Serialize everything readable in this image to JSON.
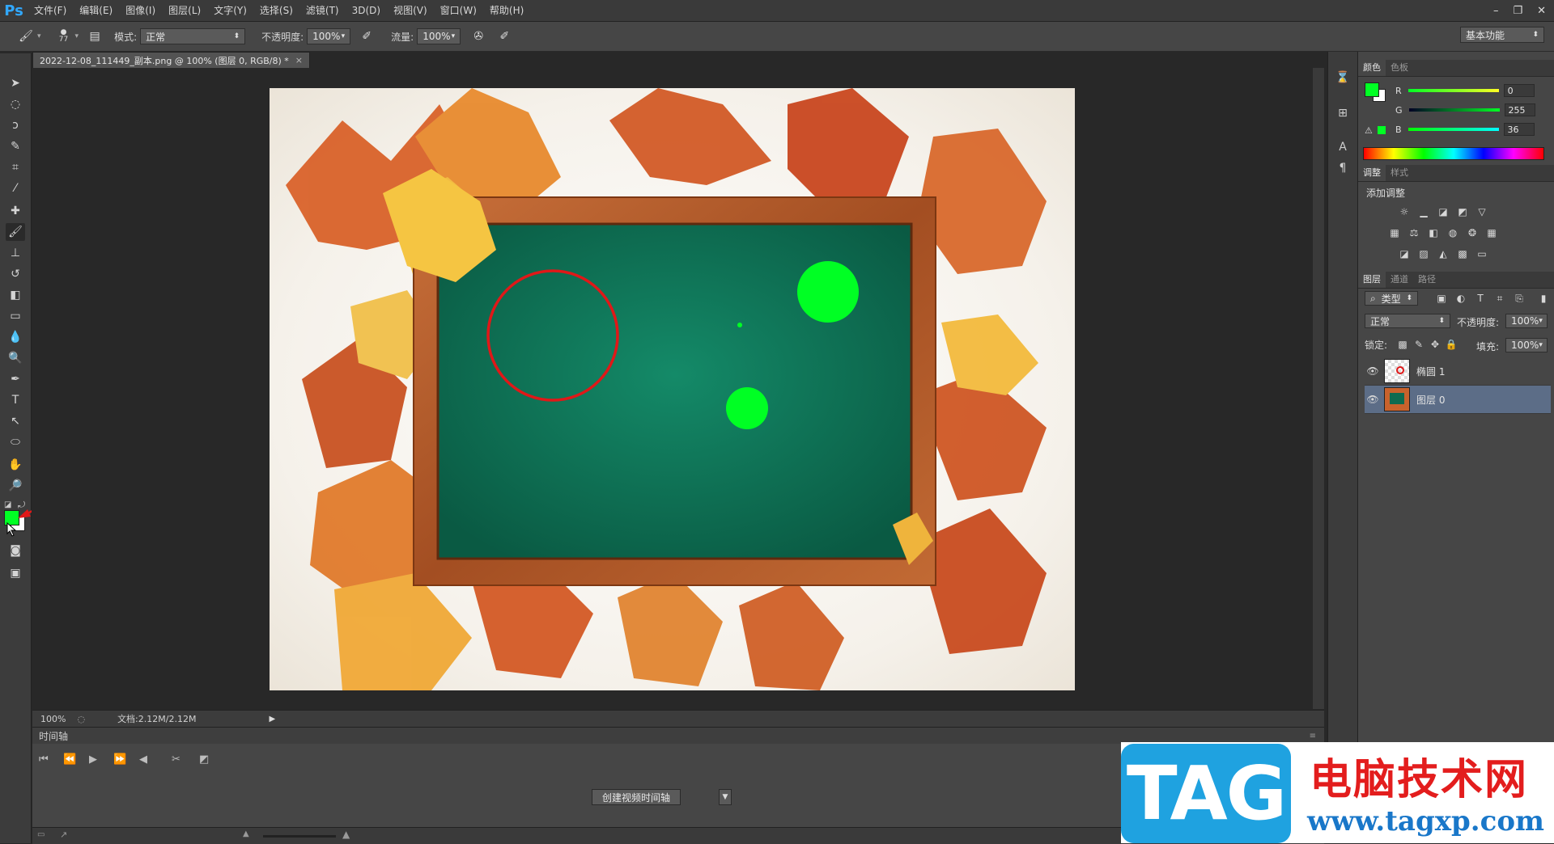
{
  "app": {
    "logo": "Ps"
  },
  "menu": {
    "items": [
      "文件(F)",
      "编辑(E)",
      "图像(I)",
      "图层(L)",
      "文字(Y)",
      "选择(S)",
      "滤镜(T)",
      "3D(D)",
      "视图(V)",
      "窗口(W)",
      "帮助(H)"
    ]
  },
  "window_controls": {
    "minimize": "–",
    "restore": "❐",
    "close": "✕"
  },
  "options_bar": {
    "brush_size": "77",
    "mode_label": "模式:",
    "mode_value": "正常",
    "opacity_label": "不透明度:",
    "opacity_value": "100%",
    "flow_label": "流量:",
    "flow_value": "100%",
    "workspace": "基本功能"
  },
  "document": {
    "tab_title": "2022-12-08_111449_副本.png @ 100% (图层 0, RGB/8) *",
    "tab_close": "×",
    "zoom": "100%",
    "doc_info": "文档:2.12M/2.12M"
  },
  "timeline": {
    "title": "时间轴",
    "create_button": "创建视频时间轴"
  },
  "color_panel": {
    "tabs": [
      "颜色",
      "色板"
    ],
    "r_label": "R",
    "r_value": "0",
    "g_label": "G",
    "g_value": "255",
    "b_label": "B",
    "b_value": "36",
    "foreground": "#00ff24",
    "background": "#ffffff"
  },
  "adjustments_panel": {
    "tabs": [
      "调整",
      "样式"
    ],
    "title": "添加调整"
  },
  "layers_panel": {
    "tabs": [
      "图层",
      "通道",
      "路径"
    ],
    "filter_kind": "类型",
    "blend_mode": "正常",
    "opacity_label": "不透明度:",
    "opacity_value": "100%",
    "lock_label": "锁定:",
    "fill_label": "填充:",
    "fill_value": "100%",
    "layers": [
      {
        "name": "椭圆 1",
        "visible": true,
        "selected": false
      },
      {
        "name": "图层 0",
        "visible": true,
        "selected": true
      }
    ]
  },
  "watermark": {
    "logo": "TAG",
    "site_cn": "电脑技术网",
    "site_url": "www.tagxp.com"
  },
  "colors": {
    "accent_green": "#00ff24",
    "annotation_red": "#e01818",
    "chalkboard": "#0f6b52",
    "frame_wood": "#b3582a"
  }
}
